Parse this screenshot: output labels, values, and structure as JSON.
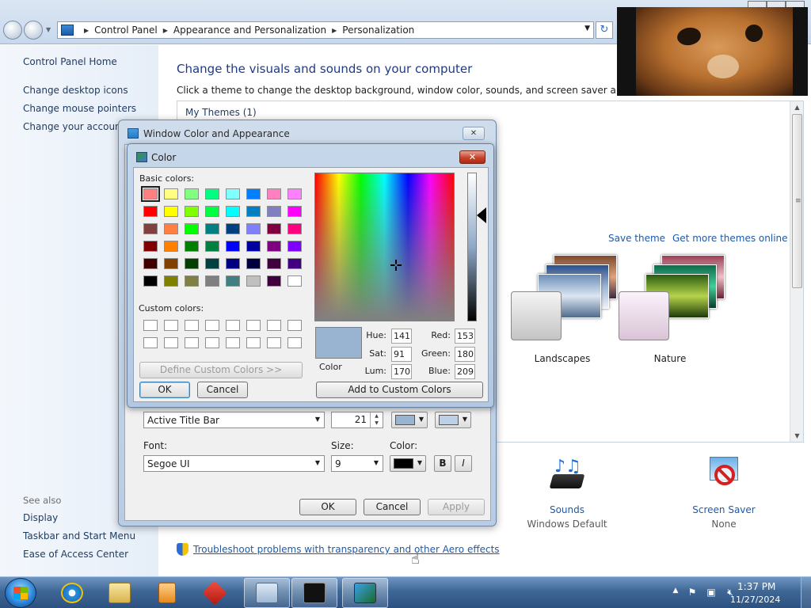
{
  "address_bar": {
    "crumbs": [
      "Control Panel",
      "Appearance and Personalization",
      "Personalization"
    ]
  },
  "left_pane": {
    "home": "Control Panel Home",
    "links": [
      "Change desktop icons",
      "Change mouse pointers",
      "Change your account p"
    ],
    "see_also_label": "See also",
    "see_also": [
      "Display",
      "Taskbar and Start Menu",
      "Ease of Access Center"
    ]
  },
  "main": {
    "title": "Change the visuals and sounds on your computer",
    "subtitle": "Click a theme to change the desktop background, window color, sounds, and screen saver all at once.",
    "my_themes": "My Themes (1)",
    "save_theme": "Save theme",
    "more_themes": "Get more themes online",
    "themes": [
      "Landscapes",
      "Nature"
    ],
    "sounds": {
      "label": "Sounds",
      "value": "Windows Default"
    },
    "screen_saver": {
      "label": "Screen Saver",
      "value": "None"
    },
    "troubleshoot": "Troubleshoot problems with transparency and other Aero effects"
  },
  "wca_dialog": {
    "title": "Window Color and Appearance",
    "item_value": "Active Title Bar",
    "size_value": "21",
    "font_label": "Font:",
    "font_value": "Segoe UI",
    "size_label": "Size:",
    "font_size_value": "9",
    "color_label": "Color:",
    "bold": "B",
    "italic": "I",
    "ok": "OK",
    "cancel": "Cancel",
    "apply": "Apply",
    "color1": "#99b4d1",
    "color2": "#bcd0e8",
    "font_color": "#000000"
  },
  "color_dialog": {
    "title": "Color",
    "basic_label": "Basic colors:",
    "custom_label": "Custom colors:",
    "define_custom": "Define Custom Colors >>",
    "ok": "OK",
    "cancel": "Cancel",
    "add_custom": "Add to Custom Colors",
    "color_word": "Color",
    "hue_label": "Hue:",
    "hue": "141",
    "sat_label": "Sat:",
    "sat": "91",
    "lum_label": "Lum:",
    "lum": "170",
    "red_label": "Red:",
    "red": "153",
    "green_label": "Green:",
    "green": "180",
    "blue_label": "Blue:",
    "blue": "209",
    "selected_color": "#99b4d1",
    "basic_colors": [
      [
        "#ff8080",
        "#ffff80",
        "#80ff80",
        "#00ff80",
        "#80ffff",
        "#0080ff",
        "#ff80c0",
        "#ff80ff"
      ],
      [
        "#ff0000",
        "#ffff00",
        "#80ff00",
        "#00ff40",
        "#00ffff",
        "#0080c0",
        "#8080c0",
        "#ff00ff"
      ],
      [
        "#804040",
        "#ff8040",
        "#00ff00",
        "#008080",
        "#004080",
        "#8080ff",
        "#800040",
        "#ff0080"
      ],
      [
        "#800000",
        "#ff8000",
        "#008000",
        "#008040",
        "#0000ff",
        "#0000a0",
        "#800080",
        "#8000ff"
      ],
      [
        "#400000",
        "#804000",
        "#004000",
        "#004040",
        "#000080",
        "#000040",
        "#400040",
        "#400080"
      ],
      [
        "#000000",
        "#808000",
        "#808040",
        "#808080",
        "#408080",
        "#c0c0c0",
        "#400040",
        "#ffffff"
      ]
    ]
  },
  "taskbar": {
    "time": "1:37 PM",
    "date": "11/27/2024"
  }
}
